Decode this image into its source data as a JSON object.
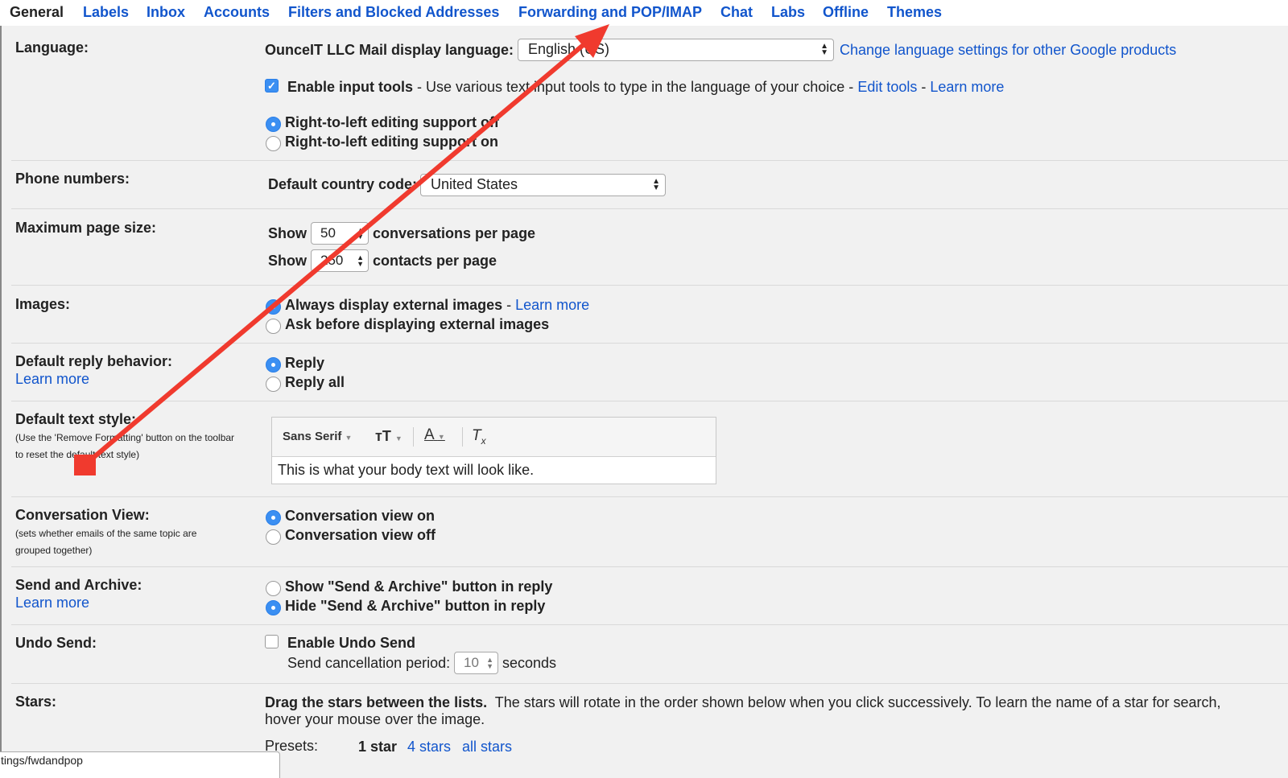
{
  "tabs": [
    "General",
    "Labels",
    "Inbox",
    "Accounts",
    "Filters and Blocked Addresses",
    "Forwarding and POP/IMAP",
    "Chat",
    "Labs",
    "Offline",
    "Themes"
  ],
  "language": {
    "label": "Language:",
    "display_label": "OunceIT LLC Mail display language:",
    "display_value": "English (US)",
    "change_link": "Change language settings for other Google products",
    "input_tools_bold": "Enable input tools",
    "input_tools_text": " - Use various text input tools to type in the language of your choice - ",
    "edit_tools": "Edit tools",
    "dash": " - ",
    "learn_more": "Learn more",
    "rtl_off": "Right-to-left editing support off",
    "rtl_on": "Right-to-left editing support on"
  },
  "phone": {
    "label": "Phone numbers:",
    "country_label": "Default country code:",
    "country_value": "United States"
  },
  "page_size": {
    "label": "Maximum page size:",
    "show": "Show",
    "conv_value": "50",
    "conv_text": "conversations per page",
    "contacts_value": "250",
    "contacts_text": "contacts per page"
  },
  "images": {
    "label": "Images:",
    "always": "Always display external images",
    "dash": " - ",
    "learn_more": "Learn more",
    "ask": "Ask before displaying external images"
  },
  "reply": {
    "label": "Default reply behavior:",
    "learn_more": "Learn more",
    "reply": "Reply",
    "reply_all": "Reply all"
  },
  "text_style": {
    "label": "Default text style:",
    "sub": "(Use the 'Remove Formatting' button on the toolbar to reset the default text style)",
    "font": "Sans Serif",
    "sample": "This is what your body text will look like."
  },
  "conversation": {
    "label": "Conversation View:",
    "sub": "(sets whether emails of the same topic are grouped together)",
    "on": "Conversation view on",
    "off": "Conversation view off"
  },
  "send_archive": {
    "label": "Send and Archive:",
    "learn_more": "Learn more",
    "show": "Show \"Send & Archive\" button in reply",
    "hide": "Hide \"Send & Archive\" button in reply"
  },
  "undo": {
    "label": "Undo Send:",
    "enable": "Enable Undo Send",
    "period_label": "Send cancellation period:",
    "period_value": "10",
    "seconds": "seconds"
  },
  "stars": {
    "label": "Stars:",
    "drag_bold": "Drag the stars between the lists.",
    "drag_text": "The stars will rotate in the order shown below when you click successively. To learn the name of a star for search,",
    "drag_text2": "hover your mouse over the image.",
    "presets_label": "Presets:",
    "preset_1": "1 star",
    "preset_4": "4 stars",
    "preset_all": "all stars"
  },
  "status_url": "tings/fwdandpop",
  "colors": {
    "link": "#1155cc",
    "annotation": "#f03a2e",
    "radio_on": "#3b8ff2"
  }
}
